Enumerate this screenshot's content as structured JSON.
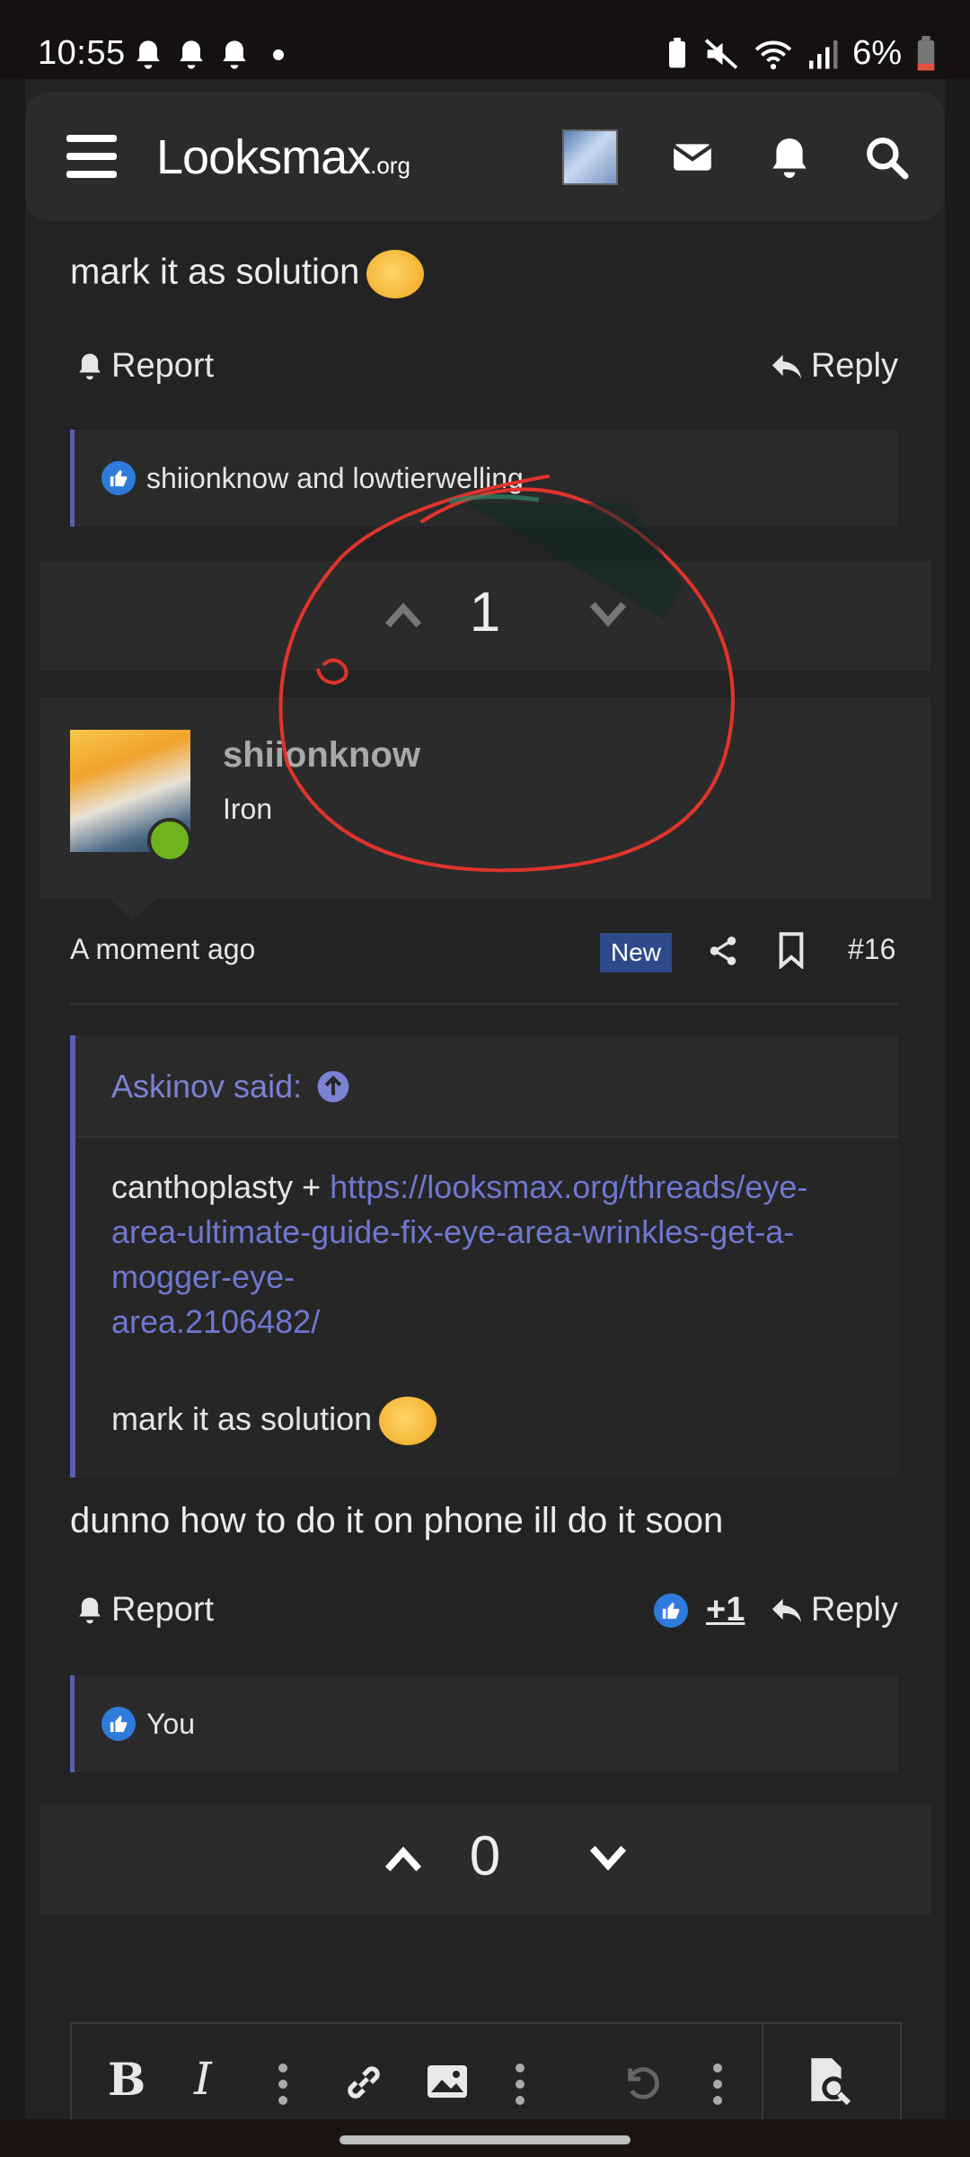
{
  "status_bar": {
    "time": "10:55",
    "battery": "6%"
  },
  "header": {
    "logo_main": "Looksmax",
    "logo_suffix": ".org"
  },
  "prev_post": {
    "text": "mark it as solution",
    "report_label": "Report",
    "reply_label": "Reply",
    "reactions_text": "shiionknow and lowtierwelling",
    "vote_count": "1"
  },
  "post": {
    "username": "shiionknow",
    "user_title": "Iron",
    "timestamp": "A moment ago",
    "new_badge": "New",
    "post_number": "#16",
    "quote": {
      "author": "Askinov said:",
      "body_prefix": "canthoplasty + ",
      "link": "https://looksmax.org/threads/eye-area-ultimate-guide-fix-eye-area-wrinkles-get-a-mogger-eye-area.2106482/",
      "link_line1": "https://looksmax.org/threads/eye-",
      "link_line2": "area-ultimate-guide-fix-eye-area-wrinkles-get-a-",
      "link_line3": "mogger-eye-",
      "link_line4": "area.2106482/",
      "body_suffix": "mark it as solution"
    },
    "text": "dunno how to do it on phone ill do it soon",
    "report_label": "Report",
    "reaction_count": "+1",
    "reply_label": "Reply",
    "reactions_text": "You",
    "vote_count": "0"
  },
  "colors": {
    "accent": "#5960b4",
    "link": "#6e78d0",
    "like": "#2e7bdc",
    "online": "#6fb31e",
    "scribble": "#e0342c"
  }
}
